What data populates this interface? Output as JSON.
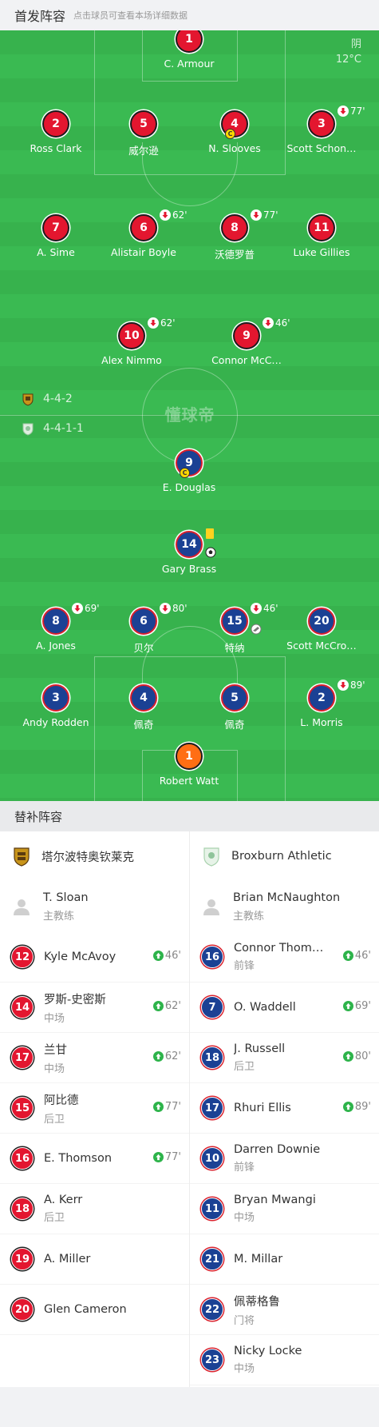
{
  "header": {
    "title": "首发阵容",
    "hint": "点击球员可查看本场详细数据"
  },
  "weather": {
    "condition": "阴",
    "temp": "12°C"
  },
  "watermark": "懂球帝",
  "formations": {
    "home": "4-4-2",
    "away": "4-4-1-1"
  },
  "home_players": [
    {
      "num": "1",
      "name": "C. Armour",
      "gk": true
    },
    {
      "num": "2",
      "name": "Ross Clark"
    },
    {
      "num": "5",
      "name": "威尔逊"
    },
    {
      "num": "4",
      "name": "N. Slooves",
      "captain": true
    },
    {
      "num": "3",
      "name": "Scott Schon…",
      "sub": "77'"
    },
    {
      "num": "7",
      "name": "A. Sime"
    },
    {
      "num": "6",
      "name": "Alistair Boyle",
      "sub": "62'"
    },
    {
      "num": "8",
      "name": "沃德罗普",
      "sub": "77'"
    },
    {
      "num": "11",
      "name": "Luke Gillies"
    },
    {
      "num": "10",
      "name": "Alex Nimmo",
      "sub": "62'"
    },
    {
      "num": "9",
      "name": "Connor McC…",
      "sub": "46'"
    }
  ],
  "away_players": [
    {
      "num": "9",
      "name": "E. Douglas",
      "captain": true
    },
    {
      "num": "14",
      "name": "Gary Brass",
      "yellow": true,
      "goal": true
    },
    {
      "num": "8",
      "name": "A. Jones",
      "sub": "69'"
    },
    {
      "num": "6",
      "name": "贝尔",
      "sub": "80'"
    },
    {
      "num": "15",
      "name": "特纳",
      "sub": "46'",
      "assist": true
    },
    {
      "num": "20",
      "name": "Scott McCro…"
    },
    {
      "num": "3",
      "name": "Andy Rodden"
    },
    {
      "num": "4",
      "name": "佩奇"
    },
    {
      "num": "5",
      "name": "佩奇"
    },
    {
      "num": "2",
      "name": "L. Morris",
      "sub": "89'"
    },
    {
      "num": "1",
      "name": "Robert Watt",
      "gk": true
    }
  ],
  "subs_header": "替补阵容",
  "home_team": {
    "name": "塔尔波特奥钦莱克",
    "coach": {
      "name": "T. Sloan",
      "role": "主教练"
    },
    "subs": [
      {
        "num": "12",
        "name": "Kyle McAvoy",
        "pos": "",
        "min": "46'"
      },
      {
        "num": "14",
        "name": "罗斯-史密斯",
        "pos": "中场",
        "min": "62'"
      },
      {
        "num": "17",
        "name": "兰甘",
        "pos": "中场",
        "min": "62'"
      },
      {
        "num": "15",
        "name": "阿比德",
        "pos": "后卫",
        "min": "77'"
      },
      {
        "num": "16",
        "name": "E. Thomson",
        "pos": "",
        "min": "77'"
      },
      {
        "num": "18",
        "name": "A. Kerr",
        "pos": "后卫",
        "min": ""
      },
      {
        "num": "19",
        "name": "A. Miller",
        "pos": "",
        "min": ""
      },
      {
        "num": "20",
        "name": "Glen Cameron",
        "pos": "",
        "min": ""
      }
    ]
  },
  "away_team": {
    "name": "Broxburn Athletic",
    "coach": {
      "name": "Brian McNaughton",
      "role": "主教练"
    },
    "subs": [
      {
        "num": "16",
        "name": "Connor Thom…",
        "pos": "前锋",
        "min": "46'"
      },
      {
        "num": "7",
        "name": "O. Waddell",
        "pos": "",
        "min": "69'"
      },
      {
        "num": "18",
        "name": "J. Russell",
        "pos": "后卫",
        "min": "80'"
      },
      {
        "num": "17",
        "name": "Rhuri Ellis",
        "pos": "",
        "min": "89'"
      },
      {
        "num": "10",
        "name": "Darren Downie",
        "pos": "前锋",
        "min": ""
      },
      {
        "num": "11",
        "name": "Bryan Mwangi",
        "pos": "中场",
        "min": ""
      },
      {
        "num": "21",
        "name": "M. Millar",
        "pos": "",
        "min": ""
      },
      {
        "num": "22",
        "name": "佩蒂格鲁",
        "pos": "门将",
        "min": ""
      },
      {
        "num": "23",
        "name": "Nicky Locke",
        "pos": "中场",
        "min": ""
      }
    ]
  },
  "colors": {
    "pitch": "#37b24d",
    "home": "#e3162f",
    "away": "#1b4194",
    "gk": "#ff6e14",
    "sub_up": "#2db34a"
  }
}
